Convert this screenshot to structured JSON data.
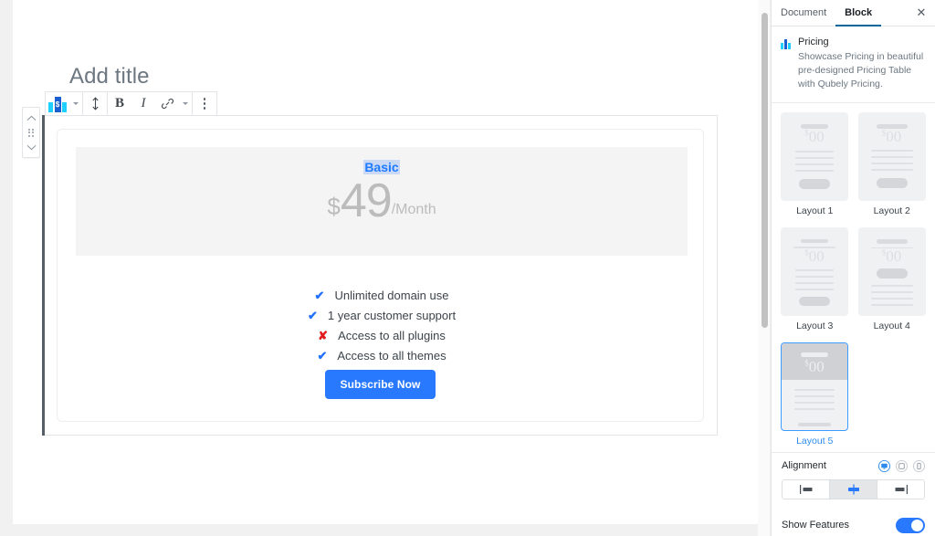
{
  "editor": {
    "post_title_placeholder": "Add title",
    "mover": {
      "up_icon": "chevron-up-icon",
      "drag_icon": "drag-handle-icon",
      "down_icon": "chevron-down-icon"
    },
    "toolbar": {
      "block_type_icon": "pricing-table-icon",
      "block_type_currency": "$",
      "block_type_caret": "chevron-down-icon",
      "vertical_align_icon": "vertical-align-icon",
      "bold_label": "B",
      "italic_label": "I",
      "link_icon": "link-icon",
      "more_formatting_caret": "chevron-down-icon",
      "more_options_icon": "ellipsis-vertical-icon"
    }
  },
  "pricing_card": {
    "plan_title": "Basic",
    "currency": "$",
    "amount": "49",
    "period": "/Month",
    "features": [
      {
        "mark": "yes",
        "glyph": "✔",
        "label": "Unlimited domain use"
      },
      {
        "mark": "yes",
        "glyph": "✔",
        "label": "1 year customer support"
      },
      {
        "mark": "no",
        "glyph": "✘",
        "label": "Access to all plugins"
      },
      {
        "mark": "yes",
        "glyph": "✔",
        "label": "Access to all themes"
      }
    ],
    "button_label": "Subscribe Now",
    "colors": {
      "plan_title": "#1e7bff",
      "price": "#bcbcbc",
      "header_bg": "#f4f4f4",
      "check": "#2271ff",
      "cross": "#e01b1b",
      "button_bg": "#2979ff"
    }
  },
  "sidebar": {
    "tabs": [
      {
        "label": "Document",
        "active": false
      },
      {
        "label": "Block",
        "active": true
      }
    ],
    "close_icon": "close-icon",
    "close_glyph": "✕",
    "block_info": {
      "icon": "pricing-table-icon",
      "title": "Pricing",
      "description": "Showcase Pricing in beautiful pre-designed Pricing Table with Qubely Pricing."
    },
    "layouts": [
      {
        "label": "Layout 1",
        "selected": false
      },
      {
        "label": "Layout 2",
        "selected": false
      },
      {
        "label": "Layout 3",
        "selected": false
      },
      {
        "label": "Layout 4",
        "selected": false
      },
      {
        "label": "Layout 5",
        "selected": true
      }
    ],
    "layout_thumb_price": "00",
    "layout_thumb_currency": "$",
    "alignment": {
      "label": "Alignment",
      "devices": [
        {
          "name": "desktop-icon",
          "active": true
        },
        {
          "name": "tablet-icon",
          "active": false
        },
        {
          "name": "mobile-icon",
          "active": false
        }
      ],
      "options": [
        {
          "name": "align-left",
          "active": false
        },
        {
          "name": "align-center",
          "active": true
        },
        {
          "name": "align-right",
          "active": false
        }
      ]
    },
    "show_features": {
      "label": "Show Features",
      "enabled": true
    },
    "accent_color": "#2d8bf0"
  }
}
